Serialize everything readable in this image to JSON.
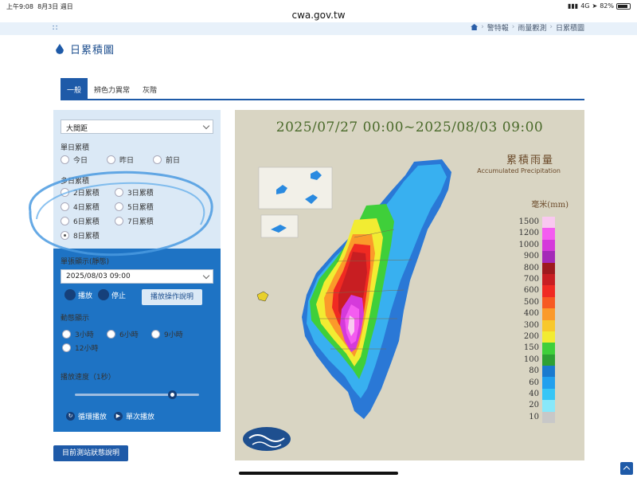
{
  "status_bar": {
    "time": "上午9:08",
    "date": "8月3日 週日",
    "network": "4G",
    "battery": "82%"
  },
  "browser": {
    "url": "cwa.gov.tw"
  },
  "breadcrumb": {
    "items": [
      "警特報",
      "雨量觀測",
      "日累積圖"
    ]
  },
  "page": {
    "title": "日累積圖"
  },
  "tabs": [
    {
      "label": "一般"
    },
    {
      "label": "辨色力異常"
    },
    {
      "label": "灰階"
    }
  ],
  "panel": {
    "scale_select": "大間距",
    "single_day": {
      "label": "單日累積",
      "options": [
        "今日",
        "昨日",
        "前日"
      ]
    },
    "multi_day": {
      "label": "多日累積",
      "options": [
        "2日累積",
        "3日累積",
        "4日累積",
        "5日累積",
        "6日累積",
        "7日累積",
        "8日累積"
      ],
      "selected": "8日累積"
    },
    "still": {
      "label": "單張顯示(靜態)",
      "datetime": "2025/08/03 09:00",
      "play": "播放",
      "stop": "停止",
      "help": "播放操作說明"
    },
    "dynamic": {
      "label": "動態顯示",
      "options": [
        "3小時",
        "6小時",
        "9小時",
        "12小時"
      ]
    },
    "speed": {
      "label": "播放速度（1秒）",
      "value_fraction": 0.8
    },
    "loop_play": "循環播放",
    "single_play": "單次播放"
  },
  "station_button": "目前測站狀態說明",
  "map": {
    "title": "2025/07/27 00:00~2025/08/03 09:00",
    "caption_cn": "累積雨量",
    "caption_en": "Accumulated Precipitation",
    "unit": "毫米(mm)",
    "legend": [
      {
        "value": "1500",
        "color": "#f9c8f0"
      },
      {
        "value": "1200",
        "color": "#f45cf0"
      },
      {
        "value": "1000",
        "color": "#d53adb"
      },
      {
        "value": "900",
        "color": "#a42ab8"
      },
      {
        "value": "800",
        "color": "#9e1a1e"
      },
      {
        "value": "700",
        "color": "#c81e22"
      },
      {
        "value": "600",
        "color": "#f02a22"
      },
      {
        "value": "500",
        "color": "#f75a22"
      },
      {
        "value": "400",
        "color": "#fb9a2a"
      },
      {
        "value": "300",
        "color": "#f8c82c"
      },
      {
        "value": "200",
        "color": "#f2ec32"
      },
      {
        "value": "150",
        "color": "#3fcf3a"
      },
      {
        "value": "100",
        "color": "#2ea034"
      },
      {
        "value": "80",
        "color": "#1a7acf"
      },
      {
        "value": "60",
        "color": "#22a0ee"
      },
      {
        "value": "40",
        "color": "#38c6f6"
      },
      {
        "value": "20",
        "color": "#88e8fa"
      },
      {
        "value": "10",
        "color": "#c8c8c8"
      }
    ]
  }
}
